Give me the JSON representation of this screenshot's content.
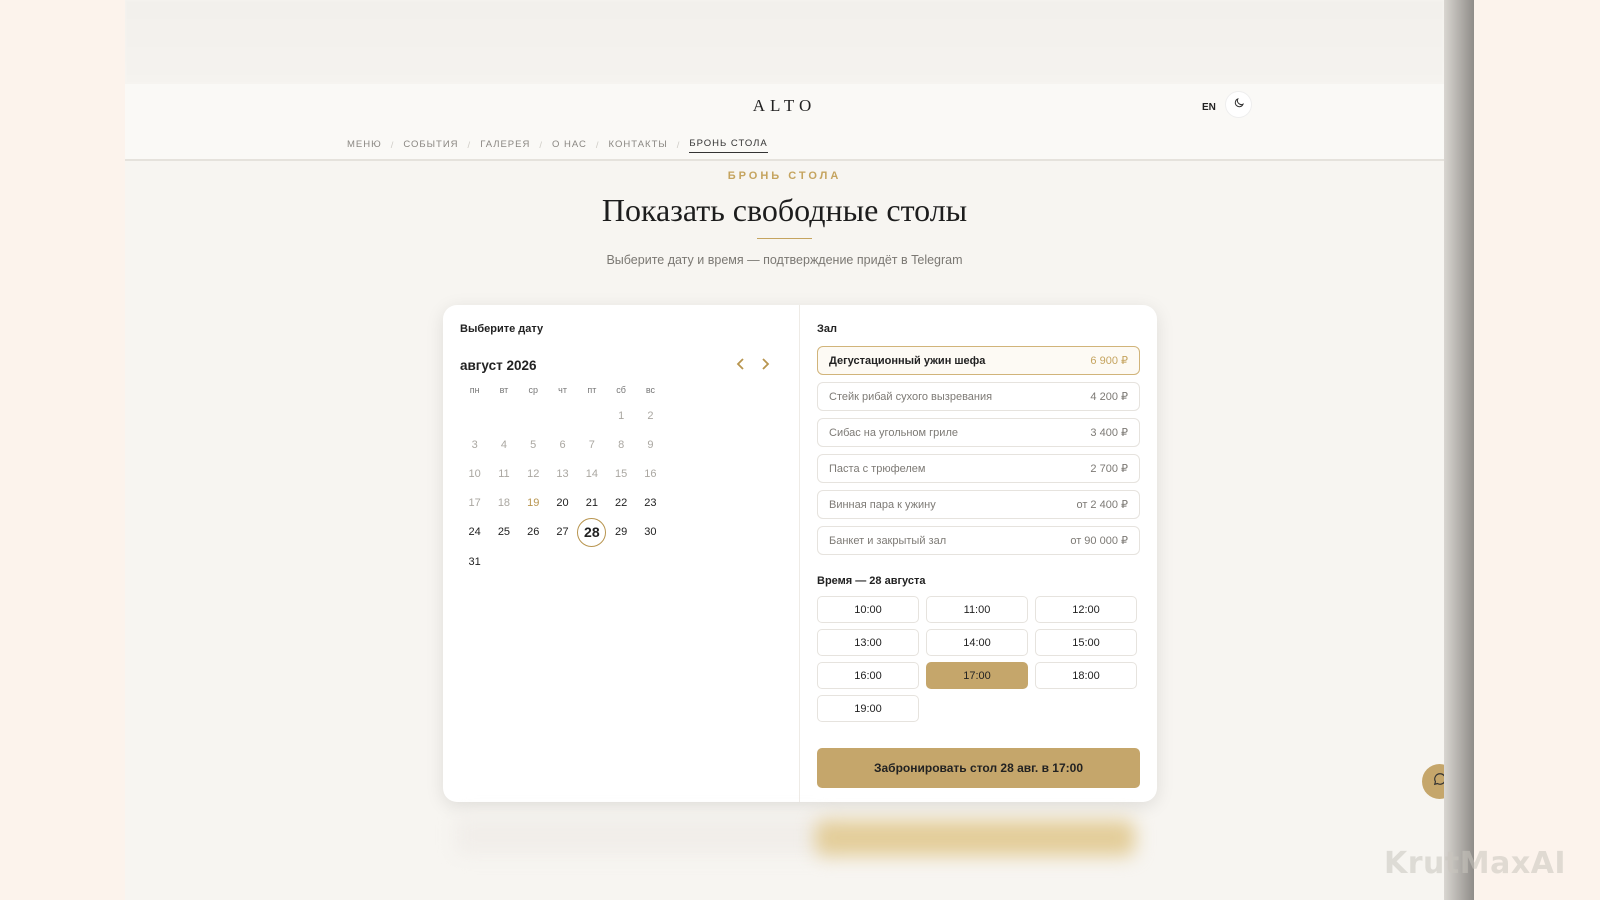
{
  "header": {
    "logo": "ALTO",
    "lang": "EN",
    "nav": [
      {
        "label": "МЕНЮ"
      },
      {
        "label": "СОБЫТИЯ"
      },
      {
        "label": "ГАЛЕРЕЯ"
      },
      {
        "label": "О НАС"
      },
      {
        "label": "КОНТАКТЫ"
      },
      {
        "label": "БРОНЬ СТОЛА",
        "active": true
      }
    ]
  },
  "hero": {
    "eyebrow": "БРОНЬ СТОЛА",
    "title": "Показать свободные столы",
    "subtitle": "Выберите дату и время — подтверждение придёт в Telegram"
  },
  "calendar": {
    "label": "Выберите дату",
    "month": "август 2026",
    "weekdays": [
      "пн",
      "вт",
      "ср",
      "чт",
      "пт",
      "сб",
      "вс"
    ],
    "days": [
      {
        "d": "",
        "s": "empty"
      },
      {
        "d": "",
        "s": "empty"
      },
      {
        "d": "",
        "s": "empty"
      },
      {
        "d": "",
        "s": "empty"
      },
      {
        "d": "",
        "s": "empty"
      },
      {
        "d": "1",
        "s": "past"
      },
      {
        "d": "2",
        "s": "past"
      },
      {
        "d": "3",
        "s": "past"
      },
      {
        "d": "4",
        "s": "past"
      },
      {
        "d": "5",
        "s": "past"
      },
      {
        "d": "6",
        "s": "past"
      },
      {
        "d": "7",
        "s": "past"
      },
      {
        "d": "8",
        "s": "past"
      },
      {
        "d": "9",
        "s": "past"
      },
      {
        "d": "10",
        "s": "past"
      },
      {
        "d": "11",
        "s": "past"
      },
      {
        "d": "12",
        "s": "past"
      },
      {
        "d": "13",
        "s": "past"
      },
      {
        "d": "14",
        "s": "past"
      },
      {
        "d": "15",
        "s": "past"
      },
      {
        "d": "16",
        "s": "past"
      },
      {
        "d": "17",
        "s": "past"
      },
      {
        "d": "18",
        "s": "past"
      },
      {
        "d": "19",
        "s": "today"
      },
      {
        "d": "20",
        "s": "available"
      },
      {
        "d": "21",
        "s": "available"
      },
      {
        "d": "22",
        "s": "available"
      },
      {
        "d": "23",
        "s": "available"
      },
      {
        "d": "24",
        "s": "available"
      },
      {
        "d": "25",
        "s": "available"
      },
      {
        "d": "26",
        "s": "available"
      },
      {
        "d": "27",
        "s": "available"
      },
      {
        "d": "28",
        "s": "selected"
      },
      {
        "d": "29",
        "s": "available"
      },
      {
        "d": "30",
        "s": "available"
      },
      {
        "d": "31",
        "s": "available"
      }
    ]
  },
  "hall": {
    "label": "Зал",
    "items": [
      {
        "name": "Дегустационный ужин шефа",
        "price": "6 900 ₽",
        "selected": true
      },
      {
        "name": "Стейк рибай сухого вызревания",
        "price": "4 200 ₽"
      },
      {
        "name": "Сибас на угольном гриле",
        "price": "3 400 ₽"
      },
      {
        "name": "Паста с трюфелем",
        "price": "2 700 ₽"
      },
      {
        "name": "Винная пара к ужину",
        "price": "от 2 400 ₽"
      },
      {
        "name": "Банкет и закрытый зал",
        "price": "от 90 000 ₽"
      }
    ],
    "time_label": "Время — 28 августа",
    "times": [
      {
        "t": "10:00"
      },
      {
        "t": "11:00"
      },
      {
        "t": "12:00"
      },
      {
        "t": "13:00"
      },
      {
        "t": "14:00"
      },
      {
        "t": "15:00"
      },
      {
        "t": "16:00"
      },
      {
        "t": "17:00",
        "selected": true
      },
      {
        "t": "18:00"
      },
      {
        "t": "19:00"
      }
    ],
    "book_label": "Забронировать стол 28 авг. в 17:00"
  },
  "watermark": "KrutMaxAI",
  "colors": {
    "accent": "#c5a66b",
    "accent_text": "#c5a45f",
    "background": "#f7f5f1"
  }
}
